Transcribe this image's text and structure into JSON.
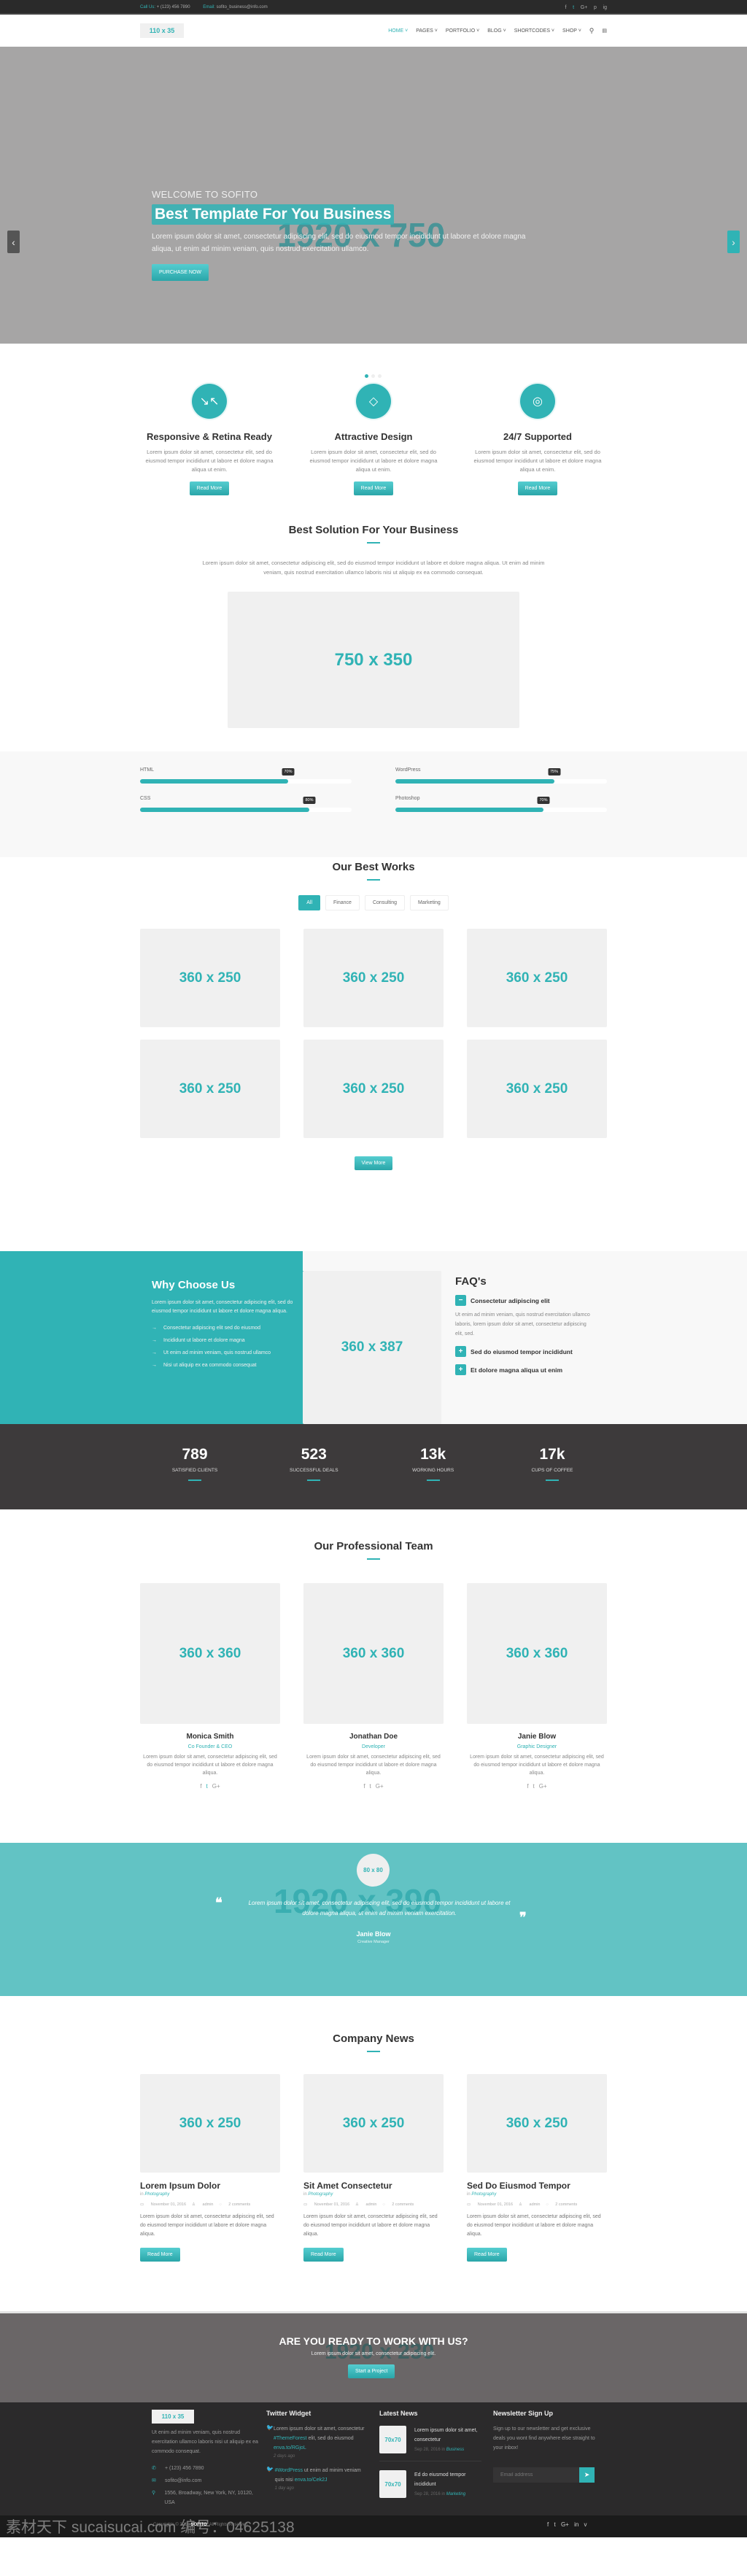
{
  "topbar": {
    "call_label": "Call Us:",
    "phone": "+ (123) 456 7890",
    "email_label": "Email:",
    "email": "sofito_business@info.com",
    "social": [
      "f",
      "t",
      "G+",
      "p",
      "ig"
    ]
  },
  "header": {
    "logo": "110 x 35",
    "nav": [
      {
        "label": "HOME ˅",
        "active": true
      },
      {
        "label": "PAGES ˅"
      },
      {
        "label": "PORTFOLIO ˅"
      },
      {
        "label": "BLOG ˅"
      },
      {
        "label": "SHORTCODES ˅"
      },
      {
        "label": "SHOP ˅"
      }
    ],
    "search_icon": "⚲",
    "cart_icon": "🛒"
  },
  "hero": {
    "placeholder": "1920 x 750",
    "welcome": "WELCOME TO SOFITO",
    "title": "Best Template For You Business",
    "desc": "Lorem ipsum dolor sit amet, consectetur adipiscing elit, sed do eiusmod tempor incididunt ut labore et dolore magna aliqua, ut enim ad minim veniam, quis nostrud exercitation ullamco.",
    "button": "PURCHASE NOW",
    "prev": "‹",
    "next": "›",
    "slides": 3,
    "active_slide": 1
  },
  "features": [
    {
      "icon": "↘↖",
      "title": "Responsive & Retina Ready",
      "desc": "Lorem ipsum dolor sit amet, consectetur elit, sed do eiusmod tempor incididunt ut labore et dolore magna aliqua ut enim.",
      "button": "Read More"
    },
    {
      "icon": "◇",
      "title": "Attractive Design",
      "desc": "Lorem ipsum dolor sit amet, consectetur elit, sed do eiusmod tempor incididunt ut labore et dolore magna aliqua ut enim.",
      "button": "Read More"
    },
    {
      "icon": "◎",
      "title": "24/7 Supported",
      "desc": "Lorem ipsum dolor sit amet, consectetur elit, sed do eiusmod tempor incididunt ut labore et dolore magna aliqua ut enim.",
      "button": "Read More"
    }
  ],
  "solution": {
    "title": "Best Solution For Your Business",
    "desc": "Lorem ipsum dolor sit amet, consectetur adipiscing elit, sed do eiusmod tempor incididunt ut labore et dolore magna aliqua. Ut enim ad minim veniam, quis nostrud exercitation ullamco laboris nisi ut aliquip ex ea commodo consequat.",
    "image": "750 x 350"
  },
  "skills": [
    {
      "name": "HTML",
      "percent": 70,
      "label": "70%"
    },
    {
      "name": "WordPress",
      "percent": 75,
      "label": "75%"
    },
    {
      "name": "CSS",
      "percent": 80,
      "label": "80%"
    },
    {
      "name": "Photoshop",
      "percent": 70,
      "label": "70%"
    }
  ],
  "works": {
    "title": "Our Best Works",
    "filters": [
      {
        "label": "All",
        "active": true
      },
      {
        "label": "Finance"
      },
      {
        "label": "Consulting"
      },
      {
        "label": "Marketing"
      }
    ],
    "items": [
      "360 x 250",
      "360 x 250",
      "360 x 250",
      "360 x 250",
      "360 x 250",
      "360 x 250"
    ],
    "button": "View More"
  },
  "why": {
    "title": "Why Choose Us",
    "desc": "Lorem ipsum dolor sit amet, consectetur adipiscing elit, sed do eiusmod tempor incididunt ut labore et dolore magna aliqua.",
    "list": [
      "Consectetur adipiscing elit sed do eiusmod",
      "Incididunt ut labore et dolore magna",
      "Ut enim ad minim veniam, quis nostrud ullamco",
      "Nisi ut aliquip ex ea commodo consequat"
    ],
    "image": "360 x 387",
    "faq_title": "FAQ's",
    "faqs": [
      {
        "q": "Consectetur adipiscing elit",
        "open": true,
        "icon": "−",
        "a": "Ut enim ad minim veniam, quis nostrud exercitation ullamco laboris, lorem ipsum dolor sit amet, consectetur adipiscing elit, sed."
      },
      {
        "q": "Sed do eiusmod tempor incididunt",
        "open": false,
        "icon": "+"
      },
      {
        "q": "Et dolore magna aliqua ut enim",
        "open": false,
        "icon": "+"
      }
    ]
  },
  "counters": [
    {
      "value": "789",
      "label": "SATISFIED CLIENTS"
    },
    {
      "value": "523",
      "label": "SUCCESSFUL DEALS"
    },
    {
      "value": "13k",
      "label": "WORKING HOURS"
    },
    {
      "value": "17k",
      "label": "CUPS OF COFFEE"
    }
  ],
  "team": {
    "title": "Our Professional Team",
    "members": [
      {
        "image": "360 x 360",
        "name": "Monica Smith",
        "role": "Co Founder & CEO",
        "desc": "Lorem ipsum dolor sit amet, consectetur adipiscing elit, sed do eiusmod tempor incididunt ut labore et dolore magna aliqua."
      },
      {
        "image": "360 x 360",
        "name": "Jonathan Doe",
        "role": "Developer",
        "desc": "Lorem ipsum dolor sit amet, consectetur adipiscing elit, sed do eiusmod tempor incididunt ut labore et dolore magna aliqua."
      },
      {
        "image": "360 x 360",
        "name": "Janie Blow",
        "role": "Graphic Designer",
        "desc": "Lorem ipsum dolor sit amet, consectetur adipiscing elit, sed do eiusmod tempor incididunt ut labore et dolore magna aliqua."
      }
    ],
    "social": [
      "f",
      "t",
      "G+"
    ]
  },
  "testimonial": {
    "placeholder": "1920 x 390",
    "avatar": "80 x 80",
    "quote": "Lorem ipsum dolor sit amet, consectetur adipiscing elit, sed do eiusmod tempor incididunt ut labore et dolore magna aliqua, ut enim ad minim veniam exercitation.",
    "name": "Janie Blow",
    "role": "Creative Manager",
    "open_quote": "❝",
    "close_quote": "❞"
  },
  "news": {
    "title": "Company News",
    "posts": [
      {
        "image": "360 x 250",
        "title": "Lorem Ipsum Dolor",
        "in": "in",
        "category": "Photography",
        "date": "November 01, 2016",
        "author": "admin",
        "comments": "2 comments",
        "desc": "Lorem ipsum dolor sit amet, consectetur adipiscing elit, sed do eiusmod tempor incididunt ut labore et dolore magna aliqua.",
        "button": "Read More"
      },
      {
        "image": "360 x 250",
        "title": "Sit Amet Consectetur",
        "in": "in",
        "category": "Photography",
        "date": "November 01, 2016",
        "author": "admin",
        "comments": "2 comments",
        "desc": "Lorem ipsum dolor sit amet, consectetur adipiscing elit, sed do eiusmod tempor incididunt ut labore et dolore magna aliqua.",
        "button": "Read More"
      },
      {
        "image": "360 x 250",
        "title": "Sed Do Eiusmod Tempor",
        "in": "in",
        "category": "Photography",
        "date": "November 01, 2016",
        "author": "admin",
        "comments": "2 comments",
        "desc": "Lorem ipsum dolor sit amet, consectetur adipiscing elit, sed do eiusmod tempor incididunt ut labore et dolore magna aliqua.",
        "button": "Read More"
      }
    ]
  },
  "cta": {
    "placeholder": "1920 x 230",
    "title": "ARE YOU READY TO WORK WITH US?",
    "desc": "Lorem ipsum dolor sit amet, consectetur adipiscing elit.",
    "button": "Start a Project"
  },
  "footer": {
    "logo": "110 x 35",
    "about": "Ut enim ad minim veniam, quis nostrud exercitation ullamco laboris nisi ut aliquip ex ea commodo consequat.",
    "phone": "+ (123) 456 7890",
    "email": "sofito@info.com",
    "address": "1556, Broadway, New York, NY, 10120, USA",
    "twitter_title": "Twitter Widget",
    "tweets": [
      {
        "pre": "Lorem ipsum dolor sit amet, consectetur ",
        "tag": "#ThemeForest",
        "mid": " elit, sed do eiusmod ",
        "link": "enva.to/RGjoL",
        "ago": "2 days ago"
      },
      {
        "pre": "",
        "tag": "#WordPress",
        "mid": " ut enim ad minim veniam quis nisi ",
        "link": "enva.to/Cek2J",
        "ago": "1 day ago"
      }
    ],
    "news_title": "Latest News",
    "news": [
      {
        "image": "70x70",
        "title": "Lorem ipsum dolor sit amet, consectetur",
        "date": "Sep 28, 2016 in",
        "category": "Business"
      },
      {
        "image": "70x70",
        "title": "Ed do eiusmod tempor incididunt",
        "date": "Sep 28, 2016 in",
        "category": "Marketing"
      }
    ],
    "newsletter_title": "Newsletter Sign Up",
    "newsletter_desc": "Sign up to our newsletter and get exclusive deals you wont find anywhere else straight to your inbox!",
    "email_placeholder": "Email address",
    "copyright_pre": "Copyrights © 2016",
    "copyright_brand": "SOFITO",
    "copyright_post": ". All Rights Reserved",
    "social": [
      "f",
      "t",
      "G+",
      "in",
      "v"
    ],
    "watermark": "素材天下 sucaisucai.com  编号：04625138"
  }
}
